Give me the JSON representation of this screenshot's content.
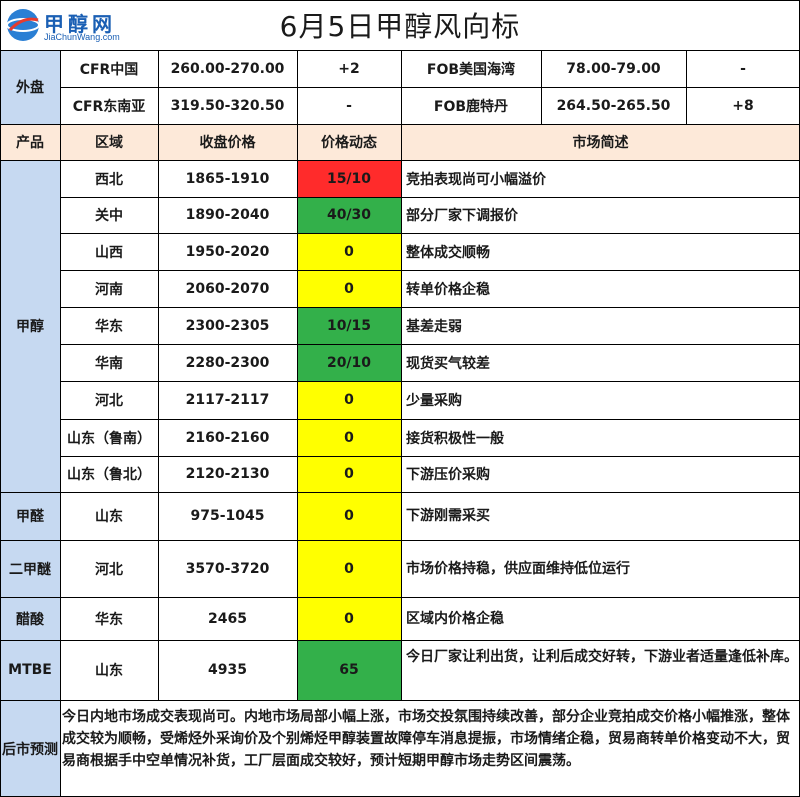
{
  "title": "6月5日甲醇风向标",
  "logo": {
    "name": "甲醇网",
    "url_text": "JiaChunWang.com"
  },
  "foreign": {
    "label": "外盘",
    "rows": [
      {
        "a_name": "CFR中国",
        "a_price": "260.00-270.00",
        "a_change": "+2",
        "b_name": "FOB美国海湾",
        "b_price": "78.00-79.00",
        "b_change": "-"
      },
      {
        "a_name": "CFR东南亚",
        "a_price": "319.50-320.50",
        "a_change": "-",
        "b_name": "FOB鹿特丹",
        "b_price": "264.50-265.50",
        "b_change": "+8"
      }
    ]
  },
  "header": {
    "product": "产品",
    "region": "区域",
    "price": "收盘价格",
    "change": "价格动态",
    "desc": "市场简述"
  },
  "methanol": {
    "label": "甲醇",
    "rows": [
      {
        "region": "西北",
        "price": "1865-1910",
        "change": "15/10",
        "color": "#ff2b2b",
        "desc": "竞拍表现尚可小幅溢价"
      },
      {
        "region": "关中",
        "price": "1890-2040",
        "change": "40/30",
        "color": "#33b04a",
        "desc": "部分厂家下调报价"
      },
      {
        "region": "山西",
        "price": "1950-2020",
        "change": "0",
        "color": "#ffff00",
        "desc": "整体成交顺畅"
      },
      {
        "region": "河南",
        "price": "2060-2070",
        "change": "0",
        "color": "#ffff00",
        "desc": "转单价格企稳"
      },
      {
        "region": "华东",
        "price": "2300-2305",
        "change": "10/15",
        "color": "#33b04a",
        "desc": "基差走弱"
      },
      {
        "region": "华南",
        "price": "2280-2300",
        "change": "20/10",
        "color": "#33b04a",
        "desc": "现货买气较差"
      },
      {
        "region": "河北",
        "price": "2117-2117",
        "change": "0",
        "color": "#ffff00",
        "desc": "少量采购"
      },
      {
        "region": "山东（鲁南）",
        "price": "2160-2160",
        "change": "0",
        "color": "#ffff00",
        "desc": "接货积极性一般"
      },
      {
        "region": "山东（鲁北）",
        "price": "2120-2130",
        "change": "0",
        "color": "#ffff00",
        "desc": "下游压价采购"
      }
    ]
  },
  "others": [
    {
      "product": "甲醛",
      "region": "山东",
      "price": "975-1045",
      "change": "0",
      "color": "#ffff00",
      "desc": "下游刚需采买"
    },
    {
      "product": "二甲醚",
      "region": "河北",
      "price": "3570-3720",
      "change": "0",
      "color": "#ffff00",
      "desc": "市场价格持稳，供应面维持低位运行"
    },
    {
      "product": "醋酸",
      "region": "华东",
      "price": "2465",
      "change": "0",
      "color": "#ffff00",
      "desc": "区域内价格企稳"
    },
    {
      "product": "MTBE",
      "region": "山东",
      "price": "4935",
      "change": "65",
      "color": "#33b04a",
      "desc": "今日厂家让利出货，让利后成交好转，下游业者适量逢低补库。"
    }
  ],
  "forecast": {
    "label": "后市预测",
    "text": "今日内地市场成交表现尚可。内地市场局部小幅上涨，市场交投氛围持续改善，部分企业竞拍成交价格小幅推涨，整体成交较为顺畅，受烯烃外采询价及个别烯烃甲醇装置故障停车消息提振，市场情绪企稳，贸易商转单价格变动不大，贸易商根据手中空单情况补货，工厂层面成交较好，预计短期甲醇市场走势区间震荡。"
  },
  "colors": {
    "side": "#c6d9f1",
    "header": "#fde9d9",
    "red": "#ff2b2b",
    "green": "#33b04a",
    "yellow": "#ffff00"
  }
}
